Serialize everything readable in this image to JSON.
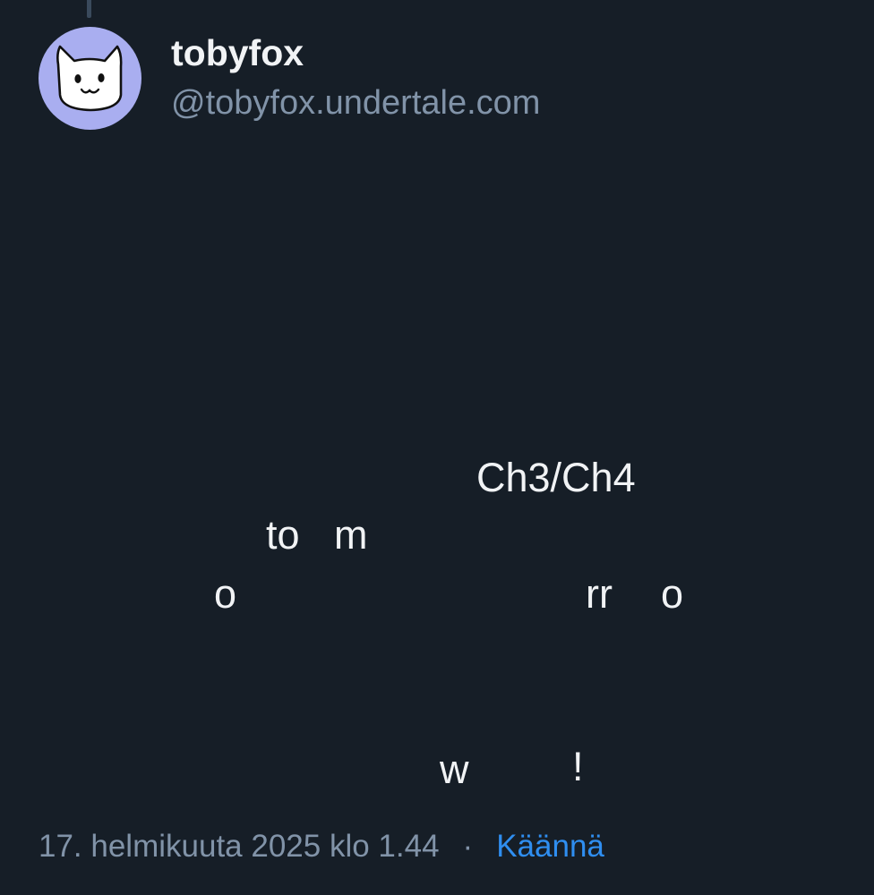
{
  "author": {
    "display_name": "tobyfox",
    "handle": "@tobyfox.undertale.com",
    "avatar_icon": "dog-face-icon"
  },
  "post": {
    "fragments": [
      "Ch3/Ch4",
      "to",
      "m",
      "o",
      "rr",
      "o",
      "w",
      "!"
    ]
  },
  "footer": {
    "timestamp": "17. helmikuuta 2025 klo 1.44",
    "separator": "·",
    "translate_label": "Käännä"
  },
  "colors": {
    "background": "#161e27",
    "text": "#f1f3f5",
    "muted": "#8193a8",
    "link": "#2f8ef0",
    "avatar_bg": "#a9aef0"
  }
}
